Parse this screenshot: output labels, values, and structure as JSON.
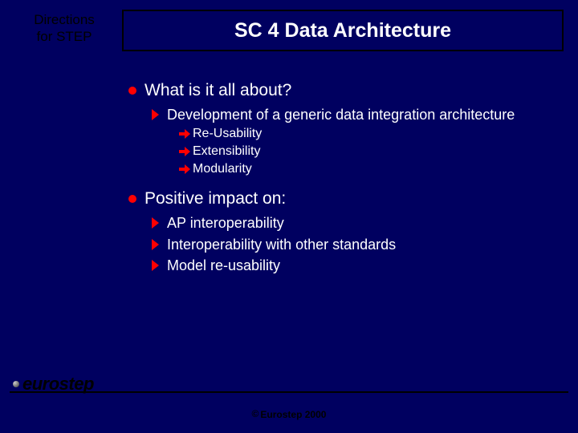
{
  "header": {
    "line1": "Directions",
    "line2": "for STEP"
  },
  "title": "SC 4 Data Architecture",
  "bullets": [
    {
      "text": "What is it all about?",
      "children": [
        {
          "text": "Development of a generic data integration architecture",
          "children": [
            {
              "text": "Re-Usability"
            },
            {
              "text": "Extensibility"
            },
            {
              "text": "Modularity"
            }
          ]
        }
      ]
    },
    {
      "text": "Positive impact on:",
      "children": [
        {
          "text": "AP interoperability"
        },
        {
          "text": "Interoperability with other standards"
        },
        {
          "text": "Model re-usability"
        }
      ]
    }
  ],
  "logo": "eurostep",
  "copyright": "Eurostep 2000"
}
